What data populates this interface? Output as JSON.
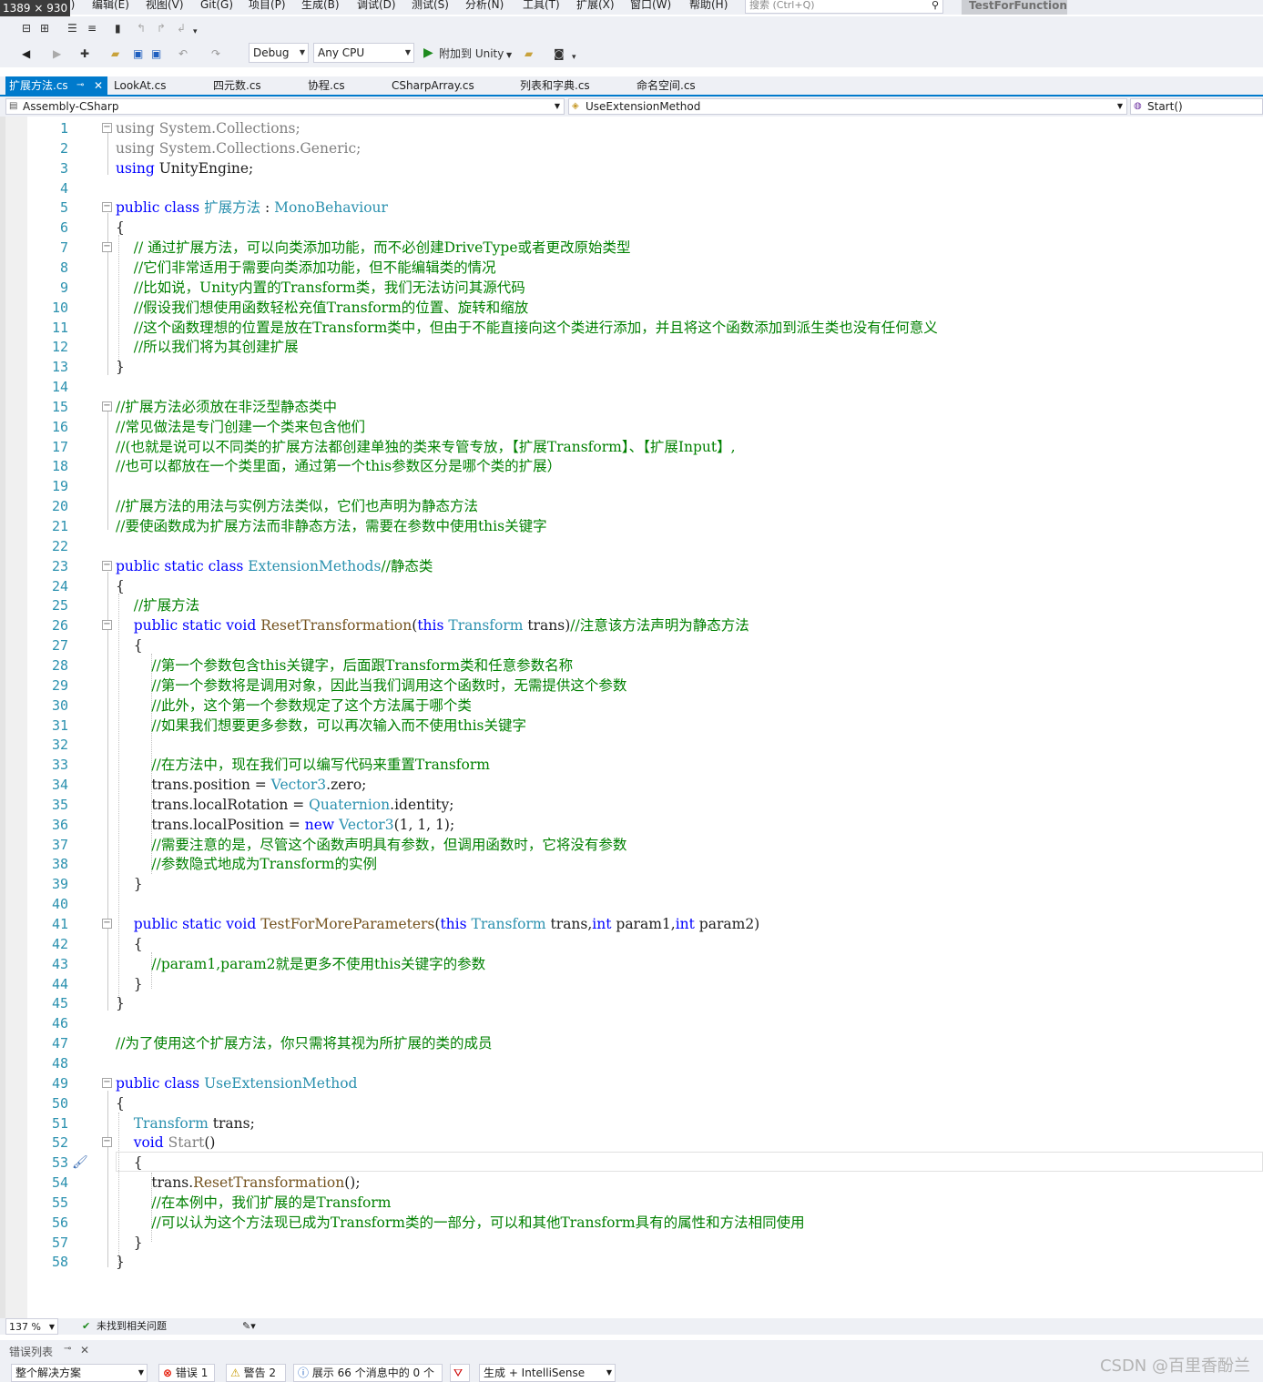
{
  "dimension_badge": "1389 × 930",
  "menu": {
    "items": [
      "(F)",
      "编辑(E)",
      "视图(V)",
      "Git(G)",
      "项目(P)",
      "生成(B)",
      "调试(D)",
      "测试(S)",
      "分析(N)",
      "工具(T)",
      "扩展(X)",
      "窗口(W)",
      "帮助(H)"
    ],
    "search_placeholder": "搜索 (Ctrl+Q)",
    "project_name": "TestForFunction"
  },
  "toolbar": {
    "config": "Debug",
    "platform": "Any CPU",
    "attach": "附加到 Unity"
  },
  "tabs": [
    {
      "label": "扩展方法.cs",
      "active": true
    },
    {
      "label": "LookAt.cs"
    },
    {
      "label": "四元数.cs"
    },
    {
      "label": "协程.cs"
    },
    {
      "label": "CSharpArray.cs"
    },
    {
      "label": "列表和字典.cs"
    },
    {
      "label": "命名空间.cs"
    }
  ],
  "nav": {
    "project": "Assembly-CSharp",
    "class": "UseExtensionMethod",
    "member": "Start()"
  },
  "colors": {
    "keyword": "#0000ff",
    "type": "#2b91af",
    "comment": "#008000",
    "accent": "#007acc"
  },
  "code": {
    "lines": [
      [
        [
          "gr",
          "using System.Collections;"
        ]
      ],
      [
        [
          "gr",
          "using System.Collections.Generic;"
        ]
      ],
      [
        [
          "kw",
          "using"
        ],
        [
          "pl",
          " UnityEngine;"
        ]
      ],
      [],
      [
        [
          "kw",
          "public class"
        ],
        [
          "pl",
          " "
        ],
        [
          "ty",
          "扩展方法"
        ],
        [
          "pl",
          " : "
        ],
        [
          "ty",
          "MonoBehaviour"
        ]
      ],
      [
        [
          "pl",
          "{"
        ]
      ],
      [
        [
          "pl",
          "    "
        ],
        [
          "cm",
          "// 通过扩展方法，可以向类添加功能，而不必创建DriveType或者更改原始类型"
        ]
      ],
      [
        [
          "pl",
          "    "
        ],
        [
          "cm",
          "//它们非常适用于需要向类添加功能，但不能编辑类的情况"
        ]
      ],
      [
        [
          "pl",
          "    "
        ],
        [
          "cm",
          "//比如说，Unity内置的Transform类，我们无法访问其源代码"
        ]
      ],
      [
        [
          "pl",
          "    "
        ],
        [
          "cm",
          "//假设我们想使用函数轻松充值Transform的位置、旋转和缩放"
        ]
      ],
      [
        [
          "pl",
          "    "
        ],
        [
          "cm",
          "//这个函数理想的位置是放在Transform类中，但由于不能直接向这个类进行添加，并且将这个函数添加到派生类也没有任何意义"
        ]
      ],
      [
        [
          "pl",
          "    "
        ],
        [
          "cm",
          "//所以我们将为其创建扩展"
        ]
      ],
      [
        [
          "pl",
          "}"
        ]
      ],
      [],
      [
        [
          "cm",
          "//扩展方法必须放在非泛型静态类中"
        ]
      ],
      [
        [
          "cm",
          "//常见做法是专门创建一个类来包含他们"
        ]
      ],
      [
        [
          "cm",
          "//(也就是说可以不同类的扩展方法都创建单独的类来专管专放，【扩展Transform】、【扩展Input】,"
        ]
      ],
      [
        [
          "cm",
          "//也可以都放在一个类里面，通过第一个this参数区分是哪个类的扩展）"
        ]
      ],
      [],
      [
        [
          "cm",
          "//扩展方法的用法与实例方法类似，它们也声明为静态方法"
        ]
      ],
      [
        [
          "cm",
          "//要使函数成为扩展方法而非静态方法，需要在参数中使用this关键字"
        ]
      ],
      [],
      [
        [
          "kw",
          "public static class"
        ],
        [
          "pl",
          " "
        ],
        [
          "ty",
          "ExtensionMethods"
        ],
        [
          "cm",
          "//静态类"
        ]
      ],
      [
        [
          "pl",
          "{"
        ]
      ],
      [
        [
          "pl",
          "    "
        ],
        [
          "cm",
          "//扩展方法"
        ]
      ],
      [
        [
          "pl",
          "    "
        ],
        [
          "kw",
          "public static void"
        ],
        [
          "pl",
          " "
        ],
        [
          "mt",
          "ResetTransformation"
        ],
        [
          "pl",
          "("
        ],
        [
          "kw",
          "this"
        ],
        [
          "pl",
          " "
        ],
        [
          "ty",
          "Transform"
        ],
        [
          "pl",
          " trans)"
        ],
        [
          "cm",
          "//注意该方法声明为静态方法"
        ]
      ],
      [
        [
          "pl",
          "    {"
        ]
      ],
      [
        [
          "pl",
          "        "
        ],
        [
          "cm",
          "//第一个参数包含this关键字，后面跟Transform类和任意参数名称"
        ]
      ],
      [
        [
          "pl",
          "        "
        ],
        [
          "cm",
          "//第一个参数将是调用对象，因此当我们调用这个函数时，无需提供这个参数"
        ]
      ],
      [
        [
          "pl",
          "        "
        ],
        [
          "cm",
          "//此外，这个第一个参数规定了这个方法属于哪个类"
        ]
      ],
      [
        [
          "pl",
          "        "
        ],
        [
          "cm",
          "//如果我们想要更多参数，可以再次输入而不使用this关键字"
        ]
      ],
      [],
      [
        [
          "pl",
          "        "
        ],
        [
          "cm",
          "//在方法中，现在我们可以编写代码来重置Transform"
        ]
      ],
      [
        [
          "pl",
          "        trans.position = "
        ],
        [
          "ty",
          "Vector3"
        ],
        [
          "pl",
          ".zero;"
        ]
      ],
      [
        [
          "pl",
          "        trans.localRotation = "
        ],
        [
          "ty",
          "Quaternion"
        ],
        [
          "pl",
          ".identity;"
        ]
      ],
      [
        [
          "pl",
          "        trans.localPosition = "
        ],
        [
          "kw",
          "new"
        ],
        [
          "pl",
          " "
        ],
        [
          "ty",
          "Vector3"
        ],
        [
          "pl",
          "(1, 1, 1);"
        ]
      ],
      [
        [
          "pl",
          "        "
        ],
        [
          "cm",
          "//需要注意的是，尽管这个函数声明具有参数，但调用函数时，它将没有参数"
        ]
      ],
      [
        [
          "pl",
          "        "
        ],
        [
          "cm",
          "//参数隐式地成为Transform的实例"
        ]
      ],
      [
        [
          "pl",
          "    }"
        ]
      ],
      [],
      [
        [
          "pl",
          "    "
        ],
        [
          "kw",
          "public static void"
        ],
        [
          "pl",
          " "
        ],
        [
          "mt",
          "TestForMoreParameters"
        ],
        [
          "pl",
          "("
        ],
        [
          "kw",
          "this"
        ],
        [
          "pl",
          " "
        ],
        [
          "ty",
          "Transform"
        ],
        [
          "pl",
          " trans,"
        ],
        [
          "kw",
          "int"
        ],
        [
          "pl",
          " param1,"
        ],
        [
          "kw",
          "int"
        ],
        [
          "pl",
          " param2)"
        ]
      ],
      [
        [
          "pl",
          "    {"
        ]
      ],
      [
        [
          "pl",
          "        "
        ],
        [
          "cm",
          "//param1,param2就是更多不使用this关键字的参数"
        ]
      ],
      [
        [
          "pl",
          "    }"
        ]
      ],
      [
        [
          "pl",
          "}"
        ]
      ],
      [],
      [
        [
          "cm",
          "//为了使用这个扩展方法，你只需将其视为所扩展的类的成员"
        ]
      ],
      [],
      [
        [
          "kw",
          "public class"
        ],
        [
          "pl",
          " "
        ],
        [
          "ty",
          "UseExtensionMethod"
        ]
      ],
      [
        [
          "pl",
          "{"
        ]
      ],
      [
        [
          "pl",
          "    "
        ],
        [
          "ty",
          "Transform"
        ],
        [
          "pl",
          " trans;"
        ]
      ],
      [
        [
          "pl",
          "    "
        ],
        [
          "kw",
          "void"
        ],
        [
          "pl",
          " "
        ],
        [
          "gr",
          "Start"
        ],
        [
          "pl",
          "()"
        ]
      ],
      [
        [
          "pl",
          "    {"
        ]
      ],
      [
        [
          "pl",
          "        trans."
        ],
        [
          "mt",
          "ResetTransformation"
        ],
        [
          "pl",
          "();"
        ]
      ],
      [
        [
          "pl",
          "        "
        ],
        [
          "cm",
          "//在本例中，我们扩展的是Transform"
        ]
      ],
      [
        [
          "pl",
          "        "
        ],
        [
          "cm",
          "//可以认为这个方法现已成为Transform类的一部分，可以和其他Transform具有的属性和方法相同使用"
        ]
      ],
      [
        [
          "pl",
          "    }"
        ]
      ],
      [
        [
          "pl",
          "}"
        ]
      ]
    ]
  },
  "status": {
    "zoom": "137 %",
    "issues": "未找到相关问题"
  },
  "error_list": {
    "title": "错误列表",
    "scope": "整个解决方案",
    "errors": "错误 1",
    "warnings": "警告 2",
    "messages": "展示 66 个消息中的 0 个",
    "build": "生成 + IntelliSense"
  },
  "watermark": "CSDN @百里香酚兰"
}
